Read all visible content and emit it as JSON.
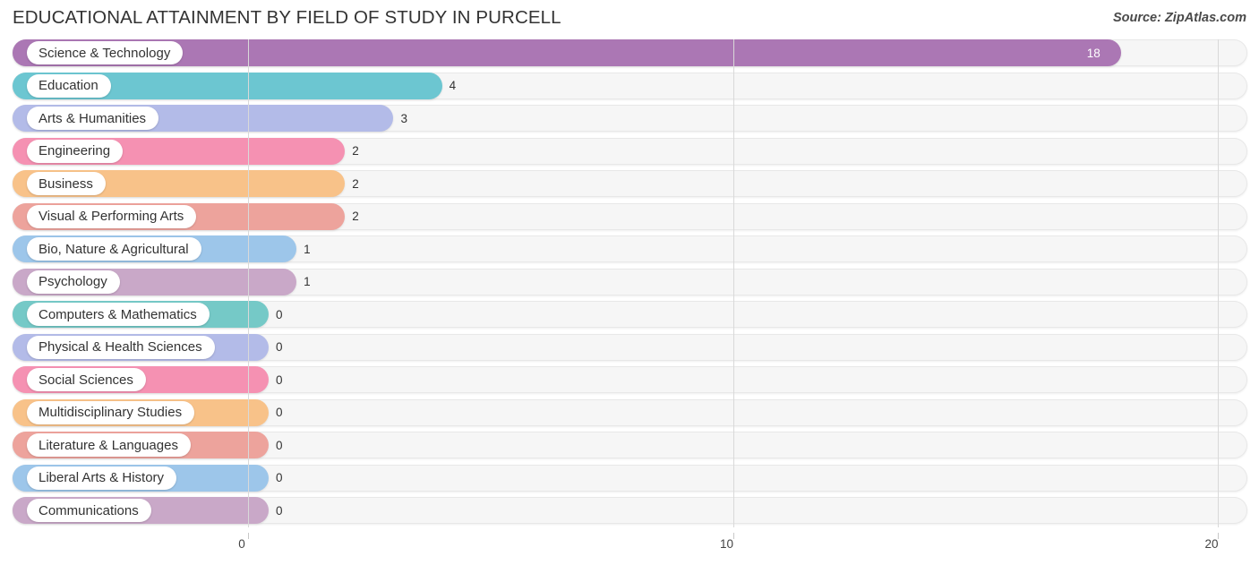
{
  "header": {
    "title": "EDUCATIONAL ATTAINMENT BY FIELD OF STUDY IN PURCELL",
    "source": "Source: ZipAtlas.com"
  },
  "chart_data": {
    "type": "bar",
    "orientation": "horizontal",
    "title": "EDUCATIONAL ATTAINMENT BY FIELD OF STUDY IN PURCELL",
    "xlabel": "",
    "ylabel": "",
    "xlim": [
      0,
      20
    ],
    "ticks": [
      "0",
      "10",
      "20"
    ],
    "tick_values": [
      0,
      10,
      20
    ],
    "grid": true,
    "legend": "none",
    "categories": [
      "Science & Technology",
      "Education",
      "Arts & Humanities",
      "Engineering",
      "Business",
      "Visual & Performing Arts",
      "Bio, Nature & Agricultural",
      "Psychology",
      "Computers & Mathematics",
      "Physical & Health Sciences",
      "Social Sciences",
      "Multidisciplinary Studies",
      "Literature & Languages",
      "Liberal Arts & History",
      "Communications"
    ],
    "values": [
      18,
      4,
      3,
      2,
      2,
      2,
      1,
      1,
      0,
      0,
      0,
      0,
      0,
      0,
      0
    ],
    "value_labels": [
      "18",
      "4",
      "3",
      "2",
      "2",
      "2",
      "1",
      "1",
      "0",
      "0",
      "0",
      "0",
      "0",
      "0",
      "0"
    ],
    "colors": [
      "#ab77b4",
      "#6cc6d1",
      "#b3bbe8",
      "#f591b2",
      "#f8c289",
      "#eda39c",
      "#9dc6ea",
      "#c9a8c8",
      "#75c9c7",
      "#b3bbe8",
      "#f591b2",
      "#f8c289",
      "#eda39c",
      "#9dc6ea",
      "#c9a8c8"
    ]
  }
}
